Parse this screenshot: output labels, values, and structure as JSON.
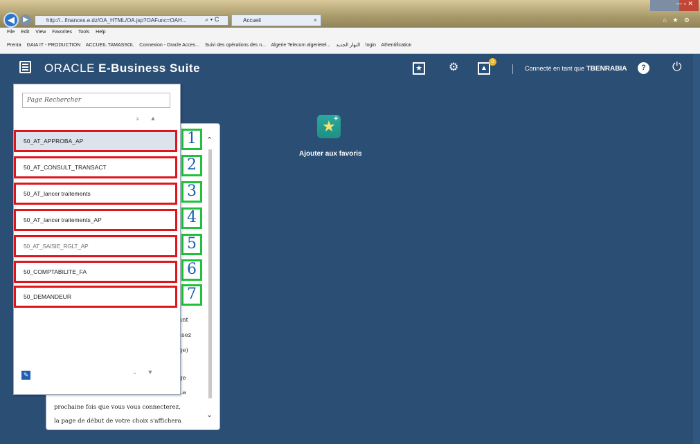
{
  "browser": {
    "address": "http://...finances.e.dz/OA_HTML/OA.jsp?OAFunc=OAH...",
    "address_icons": "⌕ ▾ C",
    "tab_title": "Accueil",
    "tab_close": "×",
    "window_buttons": "— ▫ ✕",
    "tab_extra": "⌂ ★ ⚙",
    "menu": [
      "File",
      "Edit",
      "View",
      "Favorites",
      "Tools",
      "Help"
    ],
    "favorites": [
      "Prenta",
      "GAIA IT - PRODUCTION",
      "ACCUEIL TAMASSOL",
      "Connexion - Oracle Acces...",
      "Suivi des opérations des n...",
      "Algerie Telecom algerietel...",
      "النهار الجديد",
      "login",
      "Athentification"
    ]
  },
  "header": {
    "menu_icon": "hamburger-icon",
    "brand_oracle": "ORACLE",
    "brand_suite": " E-Business Suite",
    "favorites_glyph": "★",
    "settings_glyph": "⚙",
    "notifications_glyph": "🔔",
    "notification_count": "0",
    "connected_label": "Connecté en tant que ",
    "username": "TBENRABIA",
    "help_glyph": "?",
    "power_glyph": "⏻"
  },
  "favorites_tile": {
    "glyph": "★",
    "plus": "+",
    "label": "Ajouter aux favoris"
  },
  "panel": {
    "search_placeholder": "Page Rechercher",
    "sort_glyphs": "⌅▲",
    "items": [
      "50_AT_APPROBA_AP",
      "50_AT_CONSULT_TRANSACT",
      "50_AT_lancer traitements",
      "50_AT_lancer traitements_AP",
      "50_AT_SAISIE_RGLT_AP",
      "50_COMPTABILITE_FA",
      "50_DEMANDEUR"
    ],
    "selected_index": 0,
    "edit_glyph": "✎",
    "bottom_sort_glyphs": "⌄▼"
  },
  "markers": [
    "1",
    "2",
    "3",
    "4",
    "5",
    "6",
    "7"
  ],
  "help_card": {
    "fragments": [
      "ant",
      "ssez",
      "ge)",
      "ge",
      "La"
    ],
    "line1": "prochaine fois que vous vous connecterez,",
    "line2": "la page de début de votre choix s'affichera",
    "scroll_up": "⌃",
    "scroll_down": "⌄"
  },
  "colors": {
    "app_background": "#2b4e74",
    "highlight_red": "#e0141b",
    "marker_green": "#1fc13a",
    "marker_blue": "#1b5db0",
    "tile_teal": "#1f8f86"
  }
}
